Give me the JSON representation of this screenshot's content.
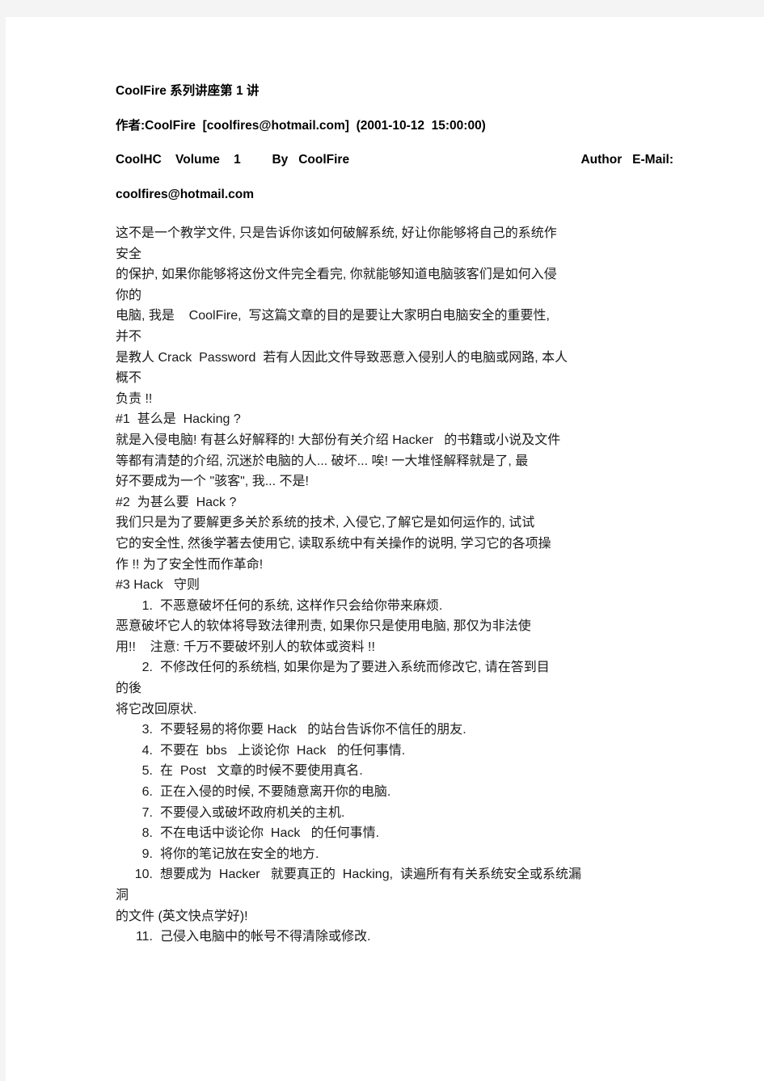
{
  "document": {
    "title": "CoolFire 系列讲座第 1 讲",
    "byline": "作者:CoolFire  [coolfires@hotmail.com]  (2001-10-12  15:00:00)",
    "masthead": {
      "left": "CoolHC    Volume    1         By   CoolFire",
      "right": "Author   E-Mail:"
    },
    "email": "coolfires@hotmail.com",
    "intro_lines": [
      "这不是一个教学文件, 只是告诉你该如何破解系统, 好让你能够将自己的系统作",
      "安全",
      "的保护, 如果你能够将这份文件完全看完, 你就能够知道电脑骇客们是如何入侵",
      "你的",
      "电脑, 我是    CoolFire,  写这篇文章的目的是要让大家明白电脑安全的重要性,",
      "并不",
      "是教人 Crack  Password  若有人因此文件导致恶意入侵别人的电脑或网路, 本人",
      "概不",
      "负责 !!"
    ],
    "section1": {
      "heading": "#1  甚么是  Hacking ?",
      "lines": [
        "就是入侵电脑! 有甚么好解释的! 大部份有关介绍 Hacker   的书籍或小说及文件",
        "等都有清楚的介绍, 沉迷於电脑的人... 破坏... 唉! 一大堆怪解释就是了, 最",
        "好不要成为一个 \"骇客\", 我... 不是!"
      ]
    },
    "section2": {
      "heading": "#2  为甚么要  Hack ?",
      "lines": [
        "我们只是为了要解更多关於系统的技术, 入侵它,了解它是如何运作的, 试试",
        "它的安全性, 然後学著去使用它, 读取系统中有关操作的说明, 学习它的各项操",
        "作 !! 为了安全性而作革命!"
      ]
    },
    "section3": {
      "heading": "#3 Hack   守则",
      "rules": [
        {
          "num": "1.",
          "text": "不恶意破坏任何的系统, 这样作只会给你带来麻烦."
        },
        {
          "num": "2.",
          "text": "不修改任何的系统档, 如果你是为了要进入系统而修改它, 请在答到目"
        },
        {
          "num": "3.",
          "text": "不要轻易的将你要 Hack   的站台告诉你不信任的朋友."
        },
        {
          "num": "4.",
          "text": "不要在  bbs   上谈论你  Hack   的任何事情."
        },
        {
          "num": "5.",
          "text": "在  Post   文章的时候不要使用真名."
        },
        {
          "num": "6.",
          "text": "正在入侵的时候, 不要随意离开你的电脑."
        },
        {
          "num": "7.",
          "text": "不要侵入或破坏政府机关的主机."
        },
        {
          "num": "8.",
          "text": "不在电话中谈论你  Hack   的任何事情."
        },
        {
          "num": "9.",
          "text": "将你的笔记放在安全的地方."
        },
        {
          "num": "10.",
          "text": "想要成为  Hacker   就要真正的  Hacking,  读遍所有有关系统安全或系统漏"
        },
        {
          "num": "11.",
          "text": "己侵入电脑中的帐号不得清除或修改."
        }
      ],
      "rule1_overflow": [
        "恶意破坏它人的软体将导致法律刑责, 如果你只是使用电脑, 那仅为非法使",
        "用!!    注意: 千万不要破坏别人的软体或资料 !!"
      ],
      "rule2_overflow": [
        "的後",
        "将它改回原状."
      ],
      "rule10_overflow": [
        "洞",
        "的文件 (英文快点学好)!"
      ]
    }
  }
}
